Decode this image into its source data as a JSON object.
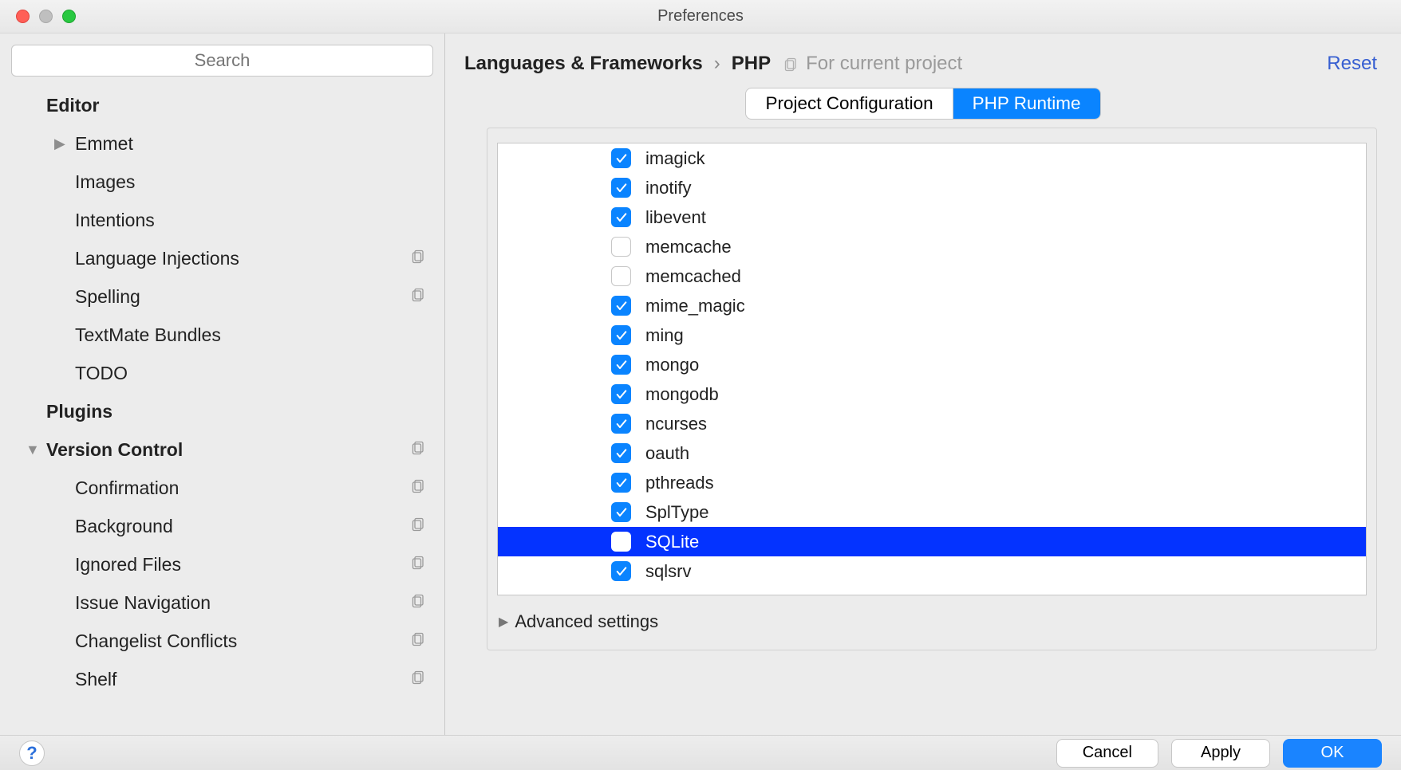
{
  "window": {
    "title": "Preferences"
  },
  "sidebar": {
    "search_placeholder": "Search",
    "sections": [
      {
        "label": "Editor",
        "header": true
      },
      {
        "label": "Emmet",
        "child": true,
        "arrow": true
      },
      {
        "label": "Images",
        "child": true
      },
      {
        "label": "Intentions",
        "child": true
      },
      {
        "label": "Language Injections",
        "child": true,
        "icon": true
      },
      {
        "label": "Spelling",
        "child": true,
        "icon": true
      },
      {
        "label": "TextMate Bundles",
        "child": true
      },
      {
        "label": "TODO",
        "child": true
      },
      {
        "label": "Plugins",
        "header": true
      },
      {
        "label": "Version Control",
        "expanded_header": true,
        "icon": true
      },
      {
        "label": "Confirmation",
        "child": true,
        "icon": true
      },
      {
        "label": "Background",
        "child": true,
        "icon": true
      },
      {
        "label": "Ignored Files",
        "child": true,
        "icon": true
      },
      {
        "label": "Issue Navigation",
        "child": true,
        "icon": true
      },
      {
        "label": "Changelist Conflicts",
        "child": true,
        "icon": true
      },
      {
        "label": "Shelf",
        "child": true,
        "icon": true
      }
    ]
  },
  "breadcrumb": {
    "parent": "Languages & Frameworks",
    "leaf": "PHP",
    "scope": "For current project",
    "reset": "Reset"
  },
  "tabs": {
    "left": "Project Configuration",
    "right": "PHP Runtime",
    "active": "right"
  },
  "extensions": [
    {
      "name": "imagick",
      "checked": true
    },
    {
      "name": "inotify",
      "checked": true
    },
    {
      "name": "libevent",
      "checked": true
    },
    {
      "name": "memcache",
      "checked": false
    },
    {
      "name": "memcached",
      "checked": false
    },
    {
      "name": "mime_magic",
      "checked": true
    },
    {
      "name": "ming",
      "checked": true
    },
    {
      "name": "mongo",
      "checked": true
    },
    {
      "name": "mongodb",
      "checked": true
    },
    {
      "name": "ncurses",
      "checked": true
    },
    {
      "name": "oauth",
      "checked": true
    },
    {
      "name": "pthreads",
      "checked": true
    },
    {
      "name": "SplType",
      "checked": true
    },
    {
      "name": "SQLite",
      "checked": false,
      "selected": true
    },
    {
      "name": "sqlsrv",
      "checked": true
    }
  ],
  "advanced": {
    "label": "Advanced settings"
  },
  "footer": {
    "cancel": "Cancel",
    "apply": "Apply",
    "ok": "OK"
  }
}
